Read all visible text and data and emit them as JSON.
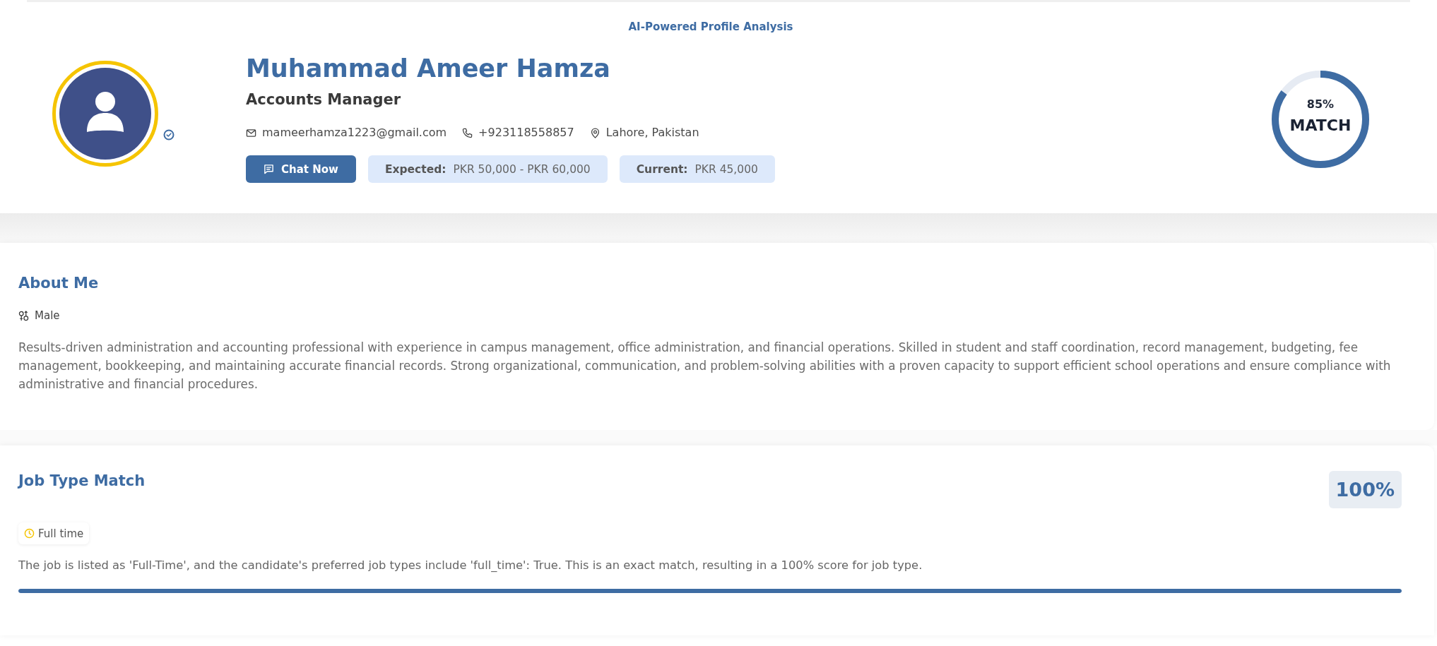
{
  "header": {
    "title": "AI-Powered Profile Analysis"
  },
  "profile": {
    "name": "Muhammad Ameer Hamza",
    "position": "Accounts Manager",
    "contacts": [
      {
        "kind": "email",
        "text": "mameerhamza1223@gmail.com"
      },
      {
        "kind": "phone",
        "text": "+923118558857"
      },
      {
        "kind": "location",
        "text": "Lahore, Pakistan"
      }
    ],
    "chat_button": "Chat Now",
    "salaries": [
      {
        "label": "Expected:",
        "value": "PKR 50,000 - PKR 60,000"
      },
      {
        "label": "Current:",
        "value": "PKR 45,000"
      }
    ]
  },
  "match": {
    "percent": "85%",
    "label": "MATCH",
    "level": 0.85
  },
  "about": {
    "title": "About Me",
    "gender": "Male",
    "bio": "Results-driven administration and accounting professional with experience in campus management, office administration, and financial operations. Skilled in student and staff coordination, record management, budgeting, fee management, bookkeeping, and maintaining accurate financial records. Strong organizational, communication, and problem-solving abilities with a proven capacity to support efficient school operations and ensure compliance with administrative and financial procedures."
  },
  "job_type": {
    "title": "Job Type Match",
    "score": "100%",
    "tags": [
      {
        "label": "Full time"
      }
    ],
    "explanation": "The job is listed as 'Full-Time', and the candidate's preferred job types include 'full_time': True. This is an exact match, resulting in a 100% score for job type.",
    "level": 1
  }
}
